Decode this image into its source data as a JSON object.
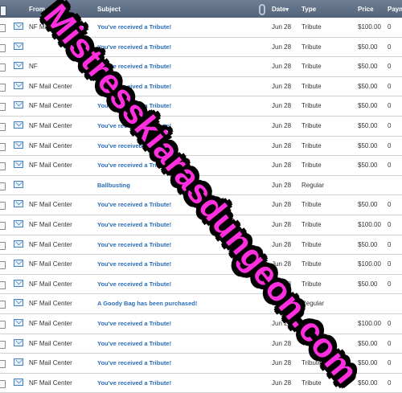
{
  "header": {
    "from": "From",
    "subject": "Subject",
    "date": "Date",
    "type": "Type",
    "price": "Price",
    "payment": "Paym"
  },
  "rows": [
    {
      "from": "NF Mail Center",
      "subject": "You've received a Tribute!",
      "date": "Jun 28",
      "type": "Tribute",
      "price": "$100.00",
      "pay": "0"
    },
    {
      "from": "",
      "subject": "You've received a Tribute!",
      "date": "Jun 28",
      "type": "Tribute",
      "price": "$50.00",
      "pay": "0"
    },
    {
      "from": "NF",
      "subject": "You've received a Tribute!",
      "date": "Jun 28",
      "type": "Tribute",
      "price": "$50.00",
      "pay": "0"
    },
    {
      "from": "NF Mail Center",
      "subject": "You've received a Tribute!",
      "date": "Jun 28",
      "type": "Tribute",
      "price": "$50.00",
      "pay": "0"
    },
    {
      "from": "NF Mail Center",
      "subject": "You've received a Tribute!",
      "date": "Jun 28",
      "type": "Tribute",
      "price": "$50.00",
      "pay": "0"
    },
    {
      "from": "NF Mail Center",
      "subject": "You've received a Tribute!",
      "date": "Jun 28",
      "type": "Tribute",
      "price": "$50.00",
      "pay": "0"
    },
    {
      "from": "NF Mail Center",
      "subject": "You've received a Tribute!",
      "date": "Jun 28",
      "type": "Tribute",
      "price": "$50.00",
      "pay": "0"
    },
    {
      "from": "NF Mail Center",
      "subject": "You've received a Tribute!",
      "date": "Jun 28",
      "type": "Tribute",
      "price": "$50.00",
      "pay": "0"
    },
    {
      "from": "",
      "subject": "Ballbusting",
      "date": "Jun 28",
      "type": "Regular",
      "price": "",
      "pay": ""
    },
    {
      "from": "NF Mail Center",
      "subject": "You've received a Tribute!",
      "date": "Jun 28",
      "type": "Tribute",
      "price": "$50.00",
      "pay": "0"
    },
    {
      "from": "NF Mail Center",
      "subject": "You've received a Tribute!",
      "date": "Jun 28",
      "type": "Tribute",
      "price": "$100.00",
      "pay": "0"
    },
    {
      "from": "NF Mail Center",
      "subject": "You've received a Tribute!",
      "date": "Jun 28",
      "type": "Tribute",
      "price": "$50.00",
      "pay": "0"
    },
    {
      "from": "NF Mail Center",
      "subject": "You've received a Tribute!",
      "date": "Jun 28",
      "type": "Tribute",
      "price": "$100.00",
      "pay": "0"
    },
    {
      "from": "NF Mail Center",
      "subject": "You've received a Tribute!",
      "date": "Jun 28",
      "type": "Tribute",
      "price": "$50.00",
      "pay": "0"
    },
    {
      "from": "NF Mail Center",
      "subject": "A Goody Bag has been purchased!",
      "date": "Jun 28",
      "type": "Regular",
      "price": "",
      "pay": ""
    },
    {
      "from": "NF Mail Center",
      "subject": "You've received a Tribute!",
      "date": "Jun 28",
      "type": "Tribute",
      "price": "$100.00",
      "pay": "0"
    },
    {
      "from": "NF Mail Center",
      "subject": "You've received a Tribute!",
      "date": "Jun 28",
      "type": "Tribute",
      "price": "$50.00",
      "pay": "0"
    },
    {
      "from": "NF Mail Center",
      "subject": "You've received a Tribute!",
      "date": "Jun 28",
      "type": "Tribute",
      "price": "$50.00",
      "pay": "0"
    },
    {
      "from": "NF Mail Center",
      "subject": "You've received a Tribute!",
      "date": "Jun 28",
      "type": "Tribute",
      "price": "$50.00",
      "pay": "0"
    }
  ],
  "watermark": "Mistresskiarasdungeon.com",
  "icons": {
    "envelope": "envelope-icon",
    "attachment": "paperclip-icon"
  },
  "colors": {
    "header_bg": "#5d6d84",
    "link": "#2a6db8",
    "watermark_fill": "#ff2fe0",
    "watermark_outline": "#000000"
  }
}
